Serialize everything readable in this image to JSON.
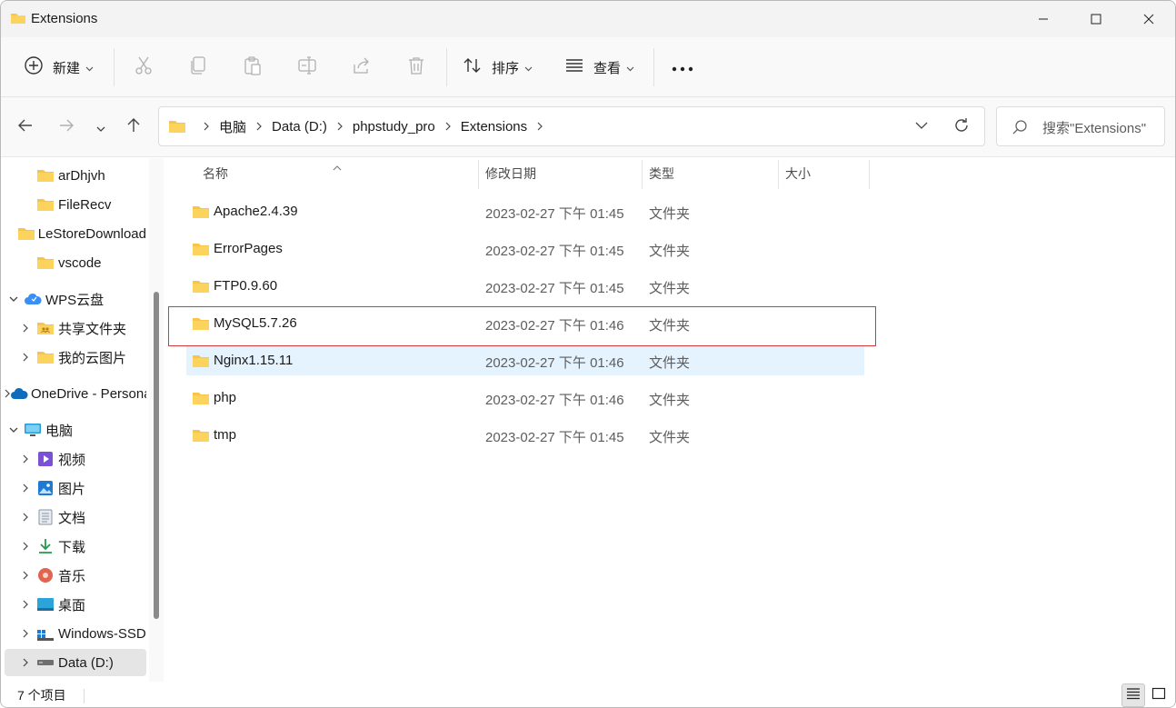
{
  "window": {
    "title": "Extensions"
  },
  "toolbar": {
    "new_label": "新建",
    "sort_label": "排序",
    "view_label": "查看",
    "more_label": "•••"
  },
  "address": {
    "crumbs": [
      "电脑",
      "Data (D:)",
      "phpstudy_pro",
      "Extensions"
    ]
  },
  "search": {
    "placeholder": "搜索\"Extensions\""
  },
  "sidebar": {
    "items": [
      {
        "label": "arDhjvh",
        "icon": "folder-icon",
        "level": 2
      },
      {
        "label": "FileRecv",
        "icon": "folder-icon",
        "level": 2
      },
      {
        "label": "LeStoreDownload",
        "icon": "folder-icon",
        "level": 2
      },
      {
        "label": "vscode",
        "icon": "folder-icon",
        "level": 2
      },
      {
        "label": "WPS云盘",
        "icon": "wps-cloud-icon",
        "level": 0,
        "expanded": true
      },
      {
        "label": "共享文件夹",
        "icon": "shared-folder-icon",
        "level": 1
      },
      {
        "label": "我的云图片",
        "icon": "folder-icon",
        "level": 1
      },
      {
        "label": "OneDrive - Personal",
        "icon": "onedrive-icon",
        "level": 0
      },
      {
        "label": "电脑",
        "icon": "computer-icon",
        "level": 0,
        "expanded": true
      },
      {
        "label": "视频",
        "icon": "videos-icon",
        "level": 1
      },
      {
        "label": "图片",
        "icon": "pictures-icon",
        "level": 1
      },
      {
        "label": "文档",
        "icon": "documents-icon",
        "level": 1
      },
      {
        "label": "下载",
        "icon": "downloads-icon",
        "level": 1
      },
      {
        "label": "音乐",
        "icon": "music-icon",
        "level": 1
      },
      {
        "label": "桌面",
        "icon": "desktop-icon",
        "level": 1
      },
      {
        "label": "Windows-SSD",
        "icon": "drive-icon",
        "level": 1
      },
      {
        "label": "Data (D:)",
        "icon": "drive-icon",
        "level": 1,
        "selected": true
      }
    ]
  },
  "columns": {
    "name": "名称",
    "date": "修改日期",
    "type": "类型",
    "size": "大小"
  },
  "files": [
    {
      "name": "Apache2.4.39",
      "date": "2023-02-27 下午 01:45",
      "type": "文件夹"
    },
    {
      "name": "ErrorPages",
      "date": "2023-02-27 下午 01:45",
      "type": "文件夹"
    },
    {
      "name": "FTP0.9.60",
      "date": "2023-02-27 下午 01:45",
      "type": "文件夹"
    },
    {
      "name": "MySQL5.7.26",
      "date": "2023-02-27 下午 01:46",
      "type": "文件夹"
    },
    {
      "name": "Nginx1.15.11",
      "date": "2023-02-27 下午 01:46",
      "type": "文件夹"
    },
    {
      "name": "php",
      "date": "2023-02-27 下午 01:46",
      "type": "文件夹"
    },
    {
      "name": "tmp",
      "date": "2023-02-27 下午 01:45",
      "type": "文件夹"
    }
  ],
  "status": {
    "count": "7 个项目"
  },
  "colors": {
    "folder": "#f8c54a",
    "highlight": "#d43a3a",
    "hover": "#e5f3ff"
  }
}
